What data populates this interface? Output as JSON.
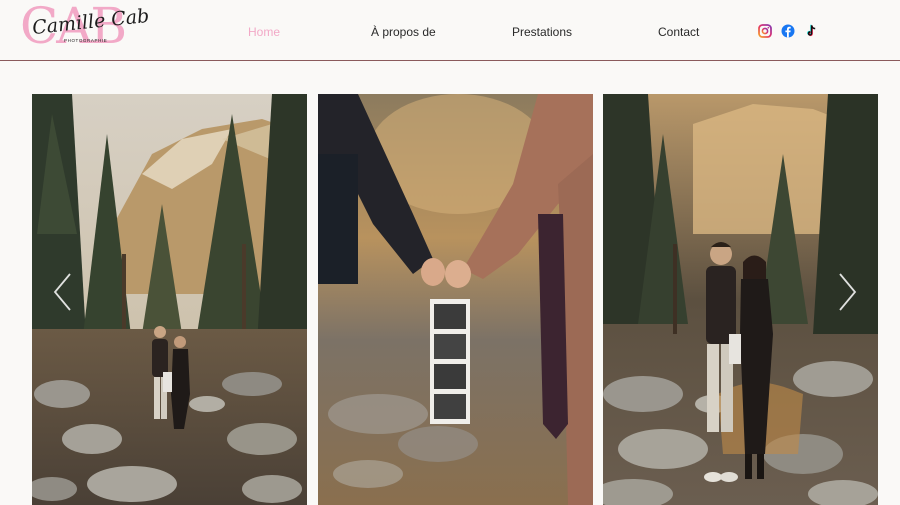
{
  "logo": {
    "monogram": "CAB",
    "name": "Camille Cab",
    "tagline": "PHOTOGRAPHIE"
  },
  "nav": {
    "items": [
      {
        "label": "Home",
        "active": true
      },
      {
        "label": "À propos de",
        "active": false
      },
      {
        "label": "Prestations",
        "active": false
      },
      {
        "label": "Contact",
        "active": false
      }
    ]
  },
  "social": [
    "instagram-icon",
    "facebook-icon",
    "tiktok-icon"
  ],
  "colors": {
    "accent_pink": "#f2a9c7",
    "divider": "#8a5a5c",
    "background": "#faf9f7"
  },
  "gallery": {
    "photos": [
      {
        "subject": "couple-holding-ultrasound-in-forest"
      },
      {
        "subject": "hands-holding-ultrasound-strip"
      },
      {
        "subject": "couple-posing-on-rocks"
      }
    ],
    "controls": [
      "arrow-left-icon",
      "arrow-right-icon"
    ]
  }
}
